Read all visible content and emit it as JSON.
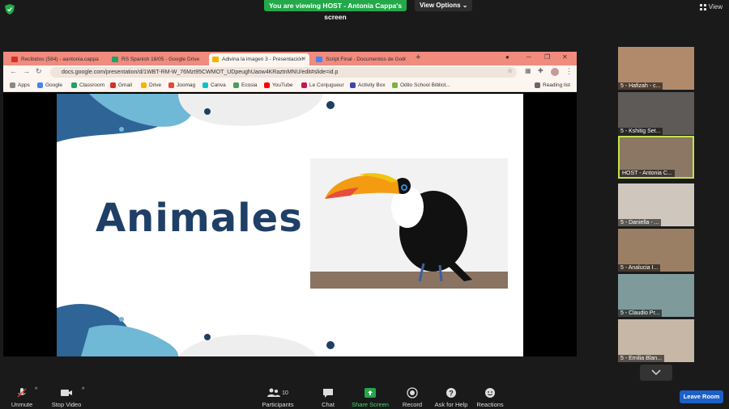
{
  "top": {
    "banner": "You are viewing HOST - Antonia Cappa's screen",
    "view_options": "View Options ⌄",
    "view": "View"
  },
  "browser": {
    "tabs": [
      {
        "label": "Recibidos (584) - aantonia.cappa",
        "icon_color": "#d93025"
      },
      {
        "label": "RS Spanish 18/05 - Google Drive",
        "icon_color": "#1fa463"
      },
      {
        "label": "Adivina la imagen 3 - Presentación",
        "icon_color": "#f4b400"
      },
      {
        "label": "Script Final - Documentos de Goo",
        "icon_color": "#4285f4"
      }
    ],
    "url": "docs.google.com/presentation/d/1WBT-RM-W_76Mzt95CWMOT_UDpeughUaow4KRaztnMNU/edit#slide=id.p",
    "bookmarks": [
      {
        "label": "Apps",
        "color": "#888"
      },
      {
        "label": "Google",
        "color": "#4285f4"
      },
      {
        "label": "Classroom",
        "color": "#1fa463"
      },
      {
        "label": "Gmail",
        "color": "#d93025"
      },
      {
        "label": "Drive",
        "color": "#f4b400"
      },
      {
        "label": "Joomag",
        "color": "#e8453c"
      },
      {
        "label": "Canva",
        "color": "#00c4cc"
      },
      {
        "label": "Ecosia",
        "color": "#4a9d5b"
      },
      {
        "label": "YouTube",
        "color": "#ff0000"
      },
      {
        "label": "Le Conjugueur",
        "color": "#c2185b"
      },
      {
        "label": "Activity Box",
        "color": "#3949ab"
      },
      {
        "label": "Odilo School Bibliot...",
        "color": "#7cb342"
      }
    ],
    "reading_list": "Reading list"
  },
  "slide": {
    "title": "Animales"
  },
  "participants": [
    {
      "name": "5 - Hafizah - c..."
    },
    {
      "name": "5 - Kshitig Set..."
    },
    {
      "name": "HOST - Antonia C..."
    },
    {
      "name": "5 - Daniella - ..."
    },
    {
      "name": "5 - Analucia I..."
    },
    {
      "name": "5 - Claudio Pr..."
    },
    {
      "name": "5 - Emilia Blan..."
    }
  ],
  "toolbar": {
    "unmute": "Unmute",
    "stop_video": "Stop Video",
    "participants": "Participants",
    "participants_count": "10",
    "chat": "Chat",
    "share_screen": "Share Screen",
    "record": "Record",
    "ask_for_help": "Ask for Help",
    "reactions": "Reactions",
    "leave_room": "Leave Room"
  },
  "colors": {
    "banner": "#23a84a",
    "share_screen": "#23a84a",
    "leave": "#1d5fc9",
    "slide_title": "#1f3f66",
    "active_border": "#c6e04a"
  }
}
